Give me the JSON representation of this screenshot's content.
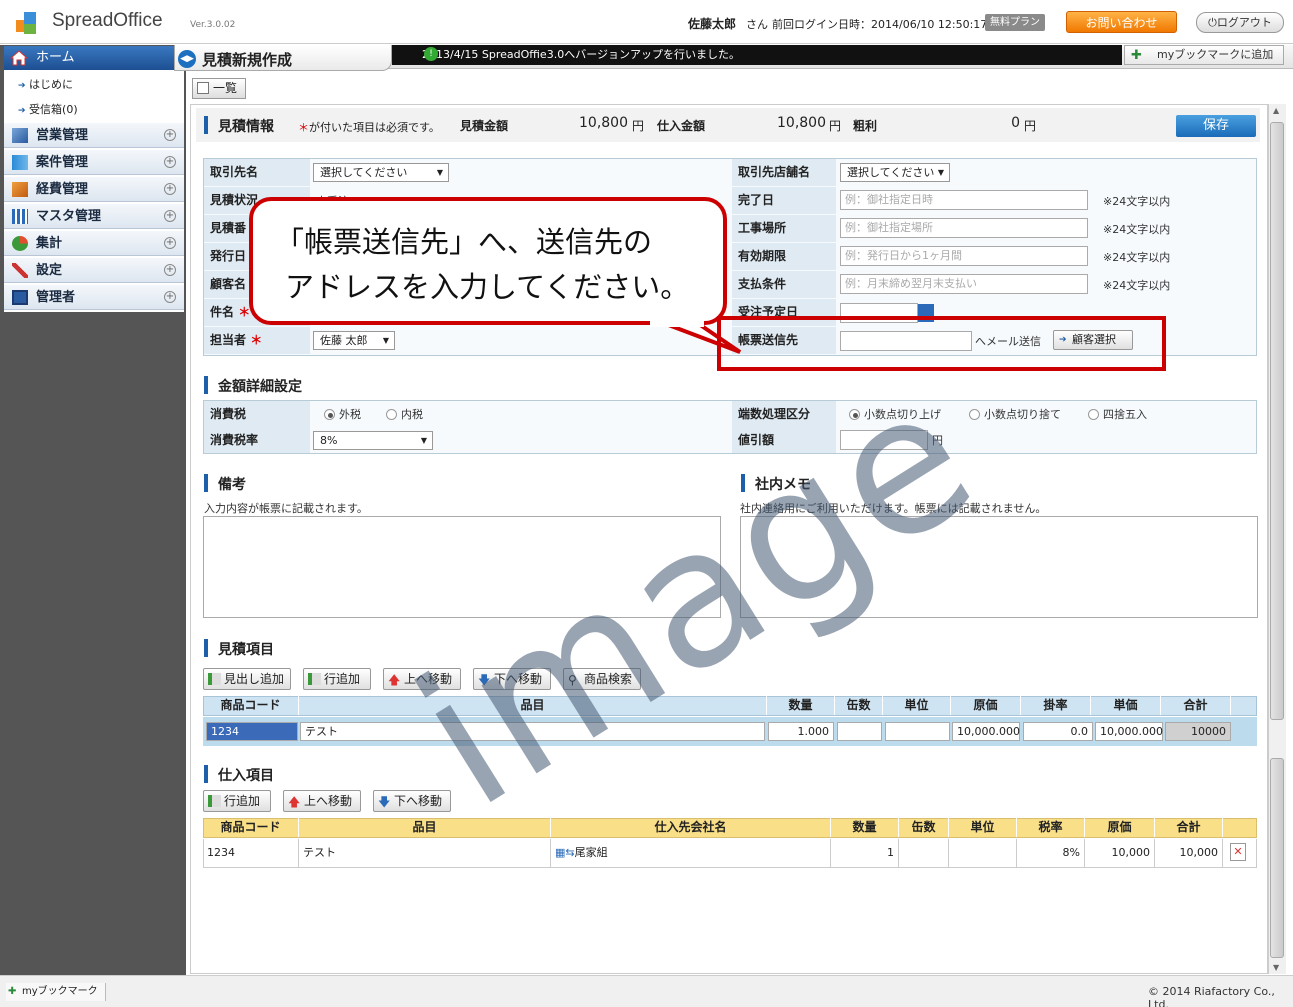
{
  "app": {
    "name": "SpreadOffice",
    "version": "Ver.3.0.02"
  },
  "header": {
    "user_name": "佐藤太郎",
    "user_suffix": "さん",
    "login_info": "前回ログイン日時：2014/06/10 12:50:17",
    "plan": "無料プラン",
    "contact": "お問い合わせ",
    "logout": "ログアウト"
  },
  "sidebar": {
    "home": "ホーム",
    "subitems": [
      "はじめに",
      "受信箱(0)"
    ],
    "items": [
      {
        "label": "営業管理",
        "icon": "sales-icon"
      },
      {
        "label": "案件管理",
        "icon": "project-icon"
      },
      {
        "label": "経費管理",
        "icon": "expense-icon"
      },
      {
        "label": "マスタ管理",
        "icon": "master-icon"
      },
      {
        "label": "集計",
        "icon": "pie-chart-icon"
      },
      {
        "label": "設定",
        "icon": "tools-icon"
      },
      {
        "label": "管理者",
        "icon": "monitor-icon"
      }
    ]
  },
  "page": {
    "title": "見積新規作成",
    "notice": "2013/4/15 SpreadOffie3.0へバージョンアップを行いました。",
    "bookmark_add": "myブックマークに追加",
    "list_button": "一覧"
  },
  "estimate": {
    "section_title": "見積情報",
    "required_note": "が付いた項目は必須です。",
    "required_mark": "＊",
    "amount_label": "見積金額",
    "amount_value": "10,800",
    "purchase_label": "仕入金額",
    "purchase_value": "10,800",
    "profit_label": "粗利",
    "profit_value": "0",
    "yen": "円",
    "save": "保存"
  },
  "form_left": {
    "client_label": "取引先名",
    "client_select": "選択してください",
    "status_label": "見積状況",
    "status_value": "未受注",
    "number_label": "見積番",
    "issue_label": "発行日",
    "customer_label": "顧客名",
    "subject_label": "件名",
    "owner_label": "担当者",
    "owner_value": "佐藤 太郎"
  },
  "form_right": {
    "store_label": "取引先店舗名",
    "store_select": "選択してください",
    "complete_label": "完了日",
    "complete_ph": "例：御社指定日時",
    "site_label": "工事場所",
    "site_ph": "例：御社指定場所",
    "valid_label": "有効期限",
    "valid_ph": "例：発行日から1ヶ月間",
    "payment_label": "支払条件",
    "payment_ph": "例：月末締め翌月末支払い",
    "limit_note": "※24文字以内",
    "order_date_label": "受注予定日",
    "send_label": "帳票送信先",
    "send_suffix": "へメール送信",
    "customer_select": "顧客選択"
  },
  "amount_detail": {
    "section_title": "金額詳細設定",
    "tax_label": "消費税",
    "tax_options": [
      "外税",
      "内税"
    ],
    "tax_rate_label": "消費税率",
    "tax_rate_value": "8%",
    "rounding_label": "端数処理区分",
    "rounding_options": [
      "小数点切り上げ",
      "小数点切り捨て",
      "四捨五入"
    ],
    "discount_label": "値引額",
    "discount_unit": "円"
  },
  "notes": {
    "title": "備考",
    "desc": "入力内容が帳票に記載されます。",
    "memo_title": "社内メモ",
    "memo_desc": "社内連絡用にご利用いただけます。帳票には記載されません。"
  },
  "items": {
    "title": "見積項目",
    "buttons": [
      "見出し追加",
      "行追加",
      "上へ移動",
      "下へ移動",
      "商品検索"
    ],
    "headers": [
      "商品コード",
      "品目",
      "数量",
      "缶数",
      "単位",
      "原価",
      "掛率",
      "単価",
      "合計"
    ],
    "row": [
      "1234",
      "テスト",
      "1.000",
      "",
      "",
      "10,000.000",
      "0.0",
      "10,000.000",
      "10000"
    ]
  },
  "purchase": {
    "title": "仕入項目",
    "buttons": [
      "行追加",
      "上へ移動",
      "下へ移動"
    ],
    "headers": [
      "商品コード",
      "品目",
      "仕入先会社名",
      "数量",
      "缶数",
      "単位",
      "税率",
      "原価",
      "合計"
    ],
    "row": [
      "1234",
      "テスト",
      "尾家組",
      "1",
      "",
      "",
      "8%",
      "10,000",
      "10,000"
    ]
  },
  "callout": {
    "line1": "「帳票送信先」へ、送信先の",
    "line2": "アドレスを入力してください。"
  },
  "watermark": "image",
  "footer": {
    "bookmark": "myブックマーク",
    "copyright": "© 2014 Riafactory Co., Ltd."
  }
}
